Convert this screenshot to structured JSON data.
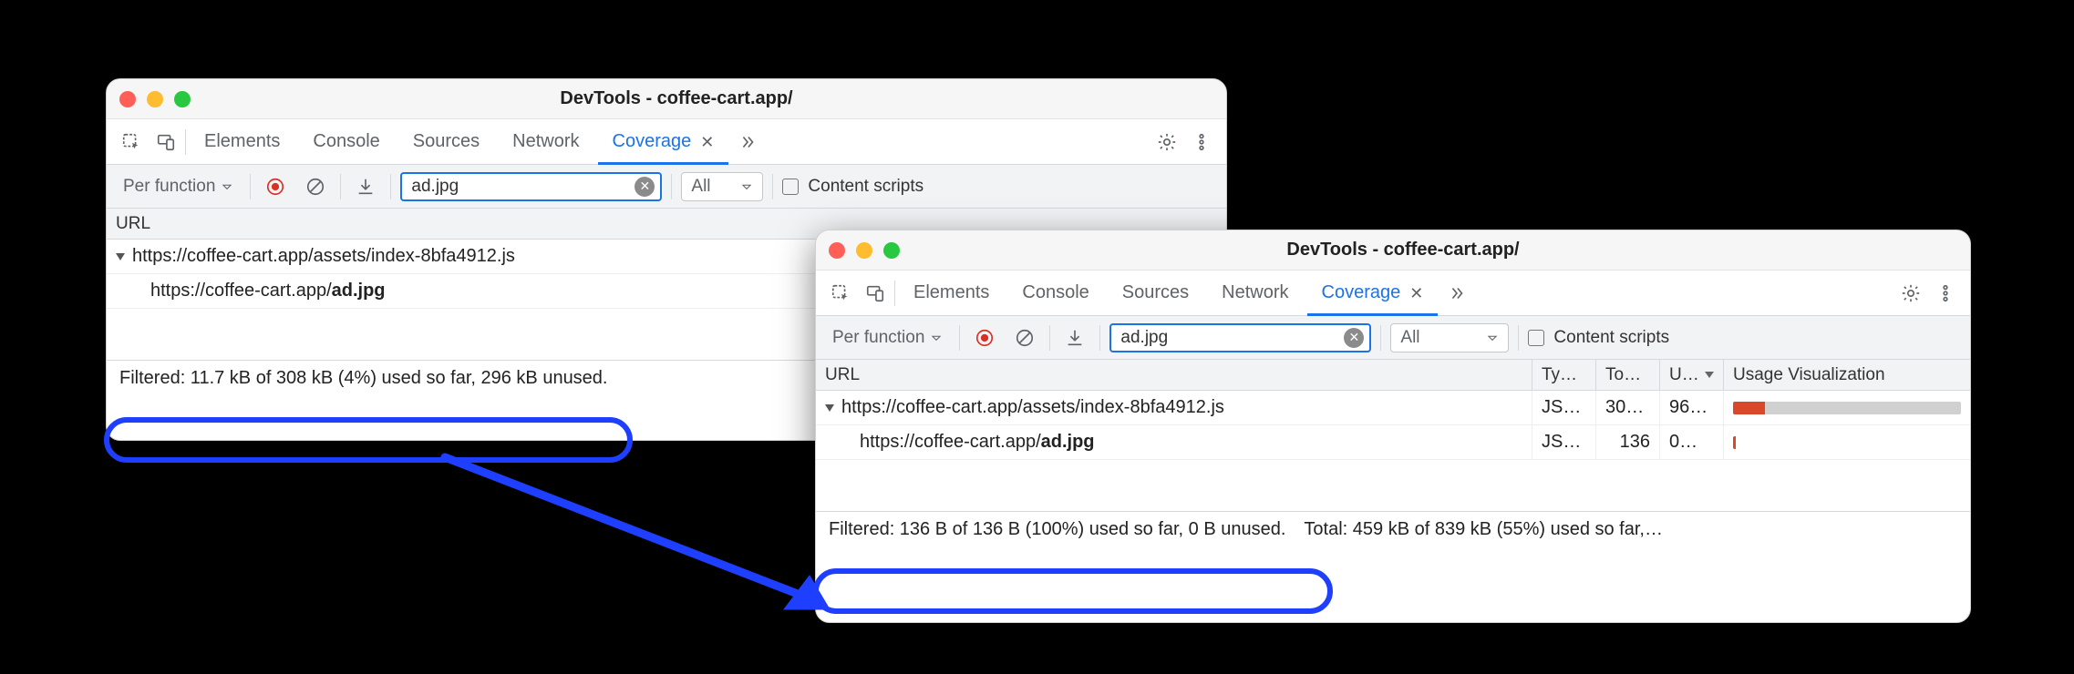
{
  "windowA": {
    "title": "DevTools - coffee-cart.app/",
    "tabs": {
      "elements": "Elements",
      "console": "Console",
      "sources": "Sources",
      "network": "Network",
      "coverage": "Coverage"
    },
    "toolbar": {
      "granularity": "Per function",
      "filter_value": "ad.jpg",
      "type_select": "All",
      "content_scripts_label": "Content scripts"
    },
    "columns": {
      "url": "URL"
    },
    "rows": {
      "r0": {
        "prefix": "https://coffee-cart.app/assets/index-8bfa4912.js"
      },
      "r1": {
        "prefix": "https://coffee-cart.app/",
        "bold": "ad.jpg"
      }
    },
    "status": {
      "filtered": "Filtered: 11.7 kB of 308 kB (4%) used so far, 296 kB unused."
    }
  },
  "windowB": {
    "title": "DevTools - coffee-cart.app/",
    "tabs": {
      "elements": "Elements",
      "console": "Console",
      "sources": "Sources",
      "network": "Network",
      "coverage": "Coverage"
    },
    "toolbar": {
      "granularity": "Per function",
      "filter_value": "ad.jpg",
      "type_select": "All",
      "content_scripts_label": "Content scripts"
    },
    "columns": {
      "url": "URL",
      "type": "Ty…",
      "total": "To…",
      "unused": "U…",
      "usage": "Usage Visualization"
    },
    "rows": {
      "r0": {
        "prefix": "https://coffee-cart.app/assets/index-8bfa4912.js",
        "type": "JS…",
        "total": "30…",
        "unused": "96…",
        "used_pct": 14
      },
      "r1": {
        "prefix": "https://coffee-cart.app/",
        "bold": "ad.jpg",
        "type": "JS…",
        "total": "136",
        "unused": "0…"
      }
    },
    "status": {
      "filtered": "Filtered: 136 B of 136 B (100%) used so far, 0 B unused.",
      "total": "Total: 459 kB of 839 kB (55%) used so far,…"
    }
  }
}
